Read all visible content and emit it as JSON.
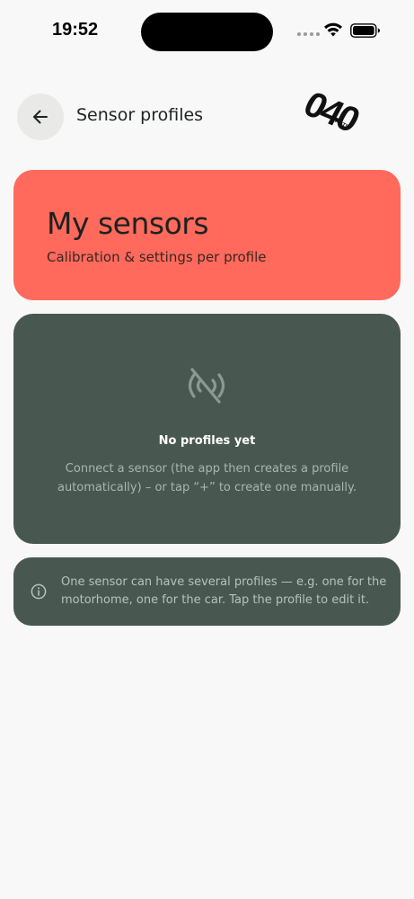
{
  "status_bar": {
    "time": "19:52"
  },
  "header": {
    "title": "Sensor profiles"
  },
  "logo": {
    "text_main": "040",
    "text_small": "PARTS"
  },
  "hero": {
    "title": "My sensors",
    "subtitle": "Calibration & settings per profile",
    "color": "#ff6a5c"
  },
  "empty_state": {
    "icon": "sensor-off-icon",
    "title": "No profiles yet",
    "description": "Connect a sensor (the app then creates a profile automatically) – or tap “+” to create one manually.",
    "color": "#485851"
  },
  "info": {
    "icon": "info-icon",
    "text": "One sensor can have several profiles — e.g. one for the motorhome, one for the car. Tap the profile to edit it."
  }
}
